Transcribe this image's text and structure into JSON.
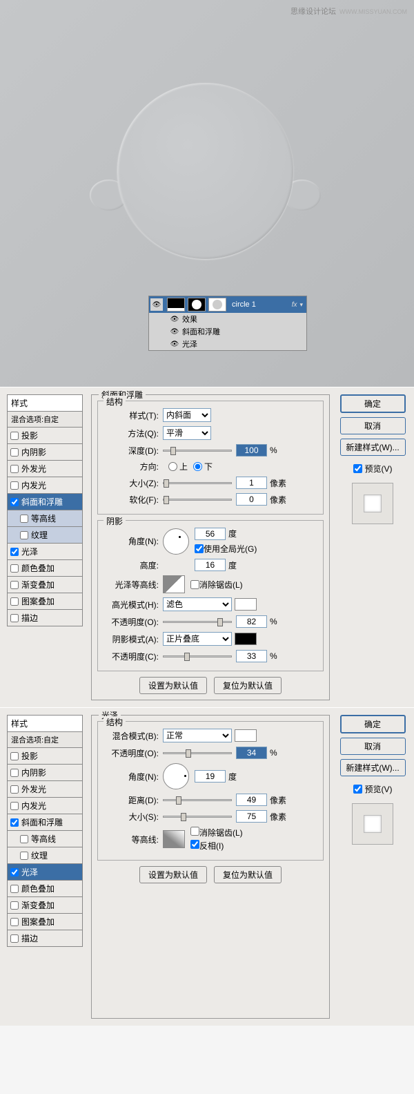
{
  "watermark": {
    "text": "思缘设计论坛",
    "url": "WWW.MISSYUAN.COM"
  },
  "layer": {
    "name": "circle 1",
    "fx": "fx",
    "effects": "效果",
    "bevel": "斜面和浮雕",
    "satin": "光泽"
  },
  "styles_header": "样式",
  "blend_options": "混合选项:自定",
  "style_items": [
    "投影",
    "内阴影",
    "外发光",
    "内发光",
    "斜面和浮雕",
    "等高线",
    "纹理",
    "光泽",
    "颜色叠加",
    "渐变叠加",
    "图案叠加",
    "描边"
  ],
  "dialog1": {
    "title": "斜面和浮雕",
    "struct": "结构",
    "style_label": "样式(T):",
    "style_val": "内斜面",
    "method_label": "方法(Q):",
    "method_val": "平滑",
    "depth_label": "深度(D):",
    "depth_val": "100",
    "depth_unit": "%",
    "dir_label": "方向:",
    "up": "上",
    "down": "下",
    "size_label": "大小(Z):",
    "size_val": "1",
    "size_unit": "像素",
    "soften_label": "软化(F):",
    "soften_val": "0",
    "soften_unit": "像素",
    "shadow": "阴影",
    "angle_label": "角度(N):",
    "angle_val": "56",
    "angle_unit": "度",
    "global": "使用全局光(G)",
    "alt_label": "高度:",
    "alt_val": "16",
    "alt_unit": "度",
    "gloss_label": "光泽等高线:",
    "anti": "消除锯齿(L)",
    "hi_mode": "高光模式(H):",
    "hi_val": "滤色",
    "hi_op": "不透明度(O):",
    "hi_op_val": "82",
    "pct": "%",
    "sh_mode": "阴影模式(A):",
    "sh_val": "正片叠底",
    "sh_op": "不透明度(C):",
    "sh_op_val": "33",
    "set_default": "设置为默认值",
    "reset_default": "复位为默认值"
  },
  "dialog2": {
    "title": "光泽",
    "struct": "结构",
    "blend_label": "混合模式(B):",
    "blend_val": "正常",
    "op_label": "不透明度(O):",
    "op_val": "34",
    "pct": "%",
    "angle_label": "角度(N):",
    "angle_val": "19",
    "angle_unit": "度",
    "dist_label": "距离(D):",
    "dist_val": "49",
    "dist_unit": "像素",
    "size_label": "大小(S):",
    "size_val": "75",
    "size_unit": "像素",
    "contour_label": "等高线:",
    "anti": "消除锯齿(L)",
    "invert": "反相(I)"
  },
  "buttons": {
    "ok": "确定",
    "cancel": "取消",
    "new_style": "新建样式(W)...",
    "preview": "预览(V)"
  }
}
